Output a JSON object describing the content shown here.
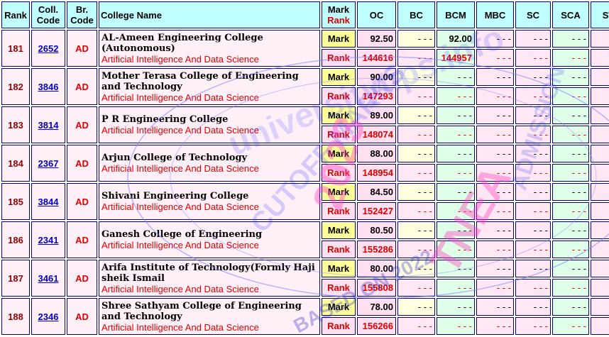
{
  "header": {
    "rank": "Rank",
    "coll_code_1": "Coll.",
    "coll_code_2": "Code",
    "br_code_1": "Br.",
    "br_code_2": "Code",
    "college_name": "College Name",
    "mark_label": "Mark",
    "rank_label": "Rank",
    "oc": "OC",
    "bc": "BC",
    "bcm": "BCM",
    "mbc": "MBC",
    "sc": "SC",
    "sca": "SCA",
    "st": "ST"
  },
  "row_labels": {
    "mark": "Mark",
    "rank": "Rank"
  },
  "empty_cell": "- - -",
  "rows": [
    {
      "rank": "181",
      "code": "2652",
      "branch": "AD",
      "college": "AL-Ameen Engineering College (Autonomous)",
      "course": "Artificial Intelligence And Data Science",
      "oc_mark": "92.50",
      "oc_rank": "144616",
      "bcm_mark": "92.00",
      "bcm_rank": "144957"
    },
    {
      "rank": "182",
      "code": "3846",
      "branch": "AD",
      "college": "Mother Terasa College of Engineering and Technology",
      "course": "Artificial Intelligence And Data Science",
      "oc_mark": "90.00",
      "oc_rank": "147293"
    },
    {
      "rank": "183",
      "code": "3814",
      "branch": "AD",
      "college": "P R Engineering College",
      "course": "Artificial Intelligence And Data Science",
      "oc_mark": "89.00",
      "oc_rank": "148074"
    },
    {
      "rank": "184",
      "code": "2367",
      "branch": "AD",
      "college": "Arjun College of Technology",
      "course": "Artificial Intelligence And Data Science",
      "oc_mark": "88.00",
      "oc_rank": "148954"
    },
    {
      "rank": "185",
      "code": "3844",
      "branch": "AD",
      "college": "Shivani Engineering College",
      "course": "Artificial Intelligence And Data Science",
      "oc_mark": "84.50",
      "oc_rank": "152427"
    },
    {
      "rank": "186",
      "code": "2341",
      "branch": "AD",
      "college": "Ganesh College of Engineering",
      "course": "Artificial Intelligence And Data Science",
      "oc_mark": "80.50",
      "oc_rank": "155286"
    },
    {
      "rank": "187",
      "code": "3461",
      "branch": "AD",
      "college": "Arifa Institute of Technology(Formly Haji sheik Ismail",
      "course": "Artificial Intelligence And Data Science",
      "oc_mark": "80.00",
      "oc_rank": "155808"
    },
    {
      "rank": "188",
      "code": "2346",
      "branch": "AD",
      "college": "Shree Sathyam College of Engineering and Technology",
      "course": "Artificial Intelligence And Data Science",
      "oc_mark": "78.00",
      "oc_rank": "156266"
    }
  ],
  "watermark": {
    "line1": "universitytips.info",
    "line2": "CUTOFF MARKS",
    "line3": "2023",
    "line4": "BASED ON 2022",
    "line5": "TNEA",
    "line6": "ADMISSION"
  },
  "colors": {
    "header_bg": "#c0ffff",
    "row_bg": "#fff0f8",
    "rank_red": "#e00000",
    "link_blue": "#0000cc"
  }
}
